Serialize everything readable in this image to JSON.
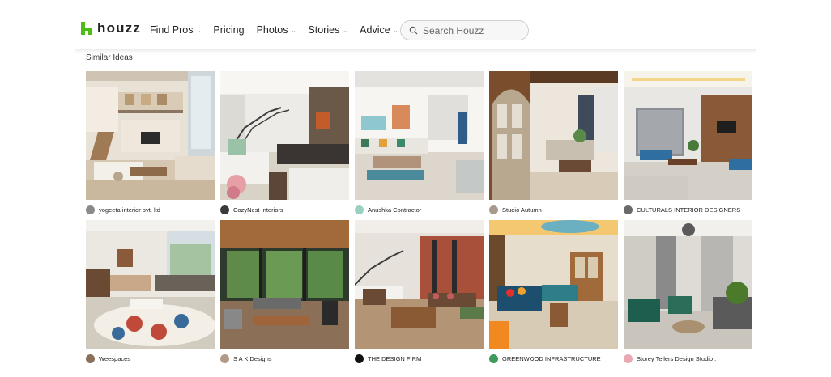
{
  "header": {
    "logo_text": "houzz",
    "nav": [
      {
        "label": "Find Pros",
        "dropdown": true
      },
      {
        "label": "Pricing",
        "dropdown": false
      },
      {
        "label": "Photos",
        "dropdown": true
      },
      {
        "label": "Stories",
        "dropdown": true
      },
      {
        "label": "Advice",
        "dropdown": true
      }
    ],
    "search_placeholder": "Search Houzz",
    "brand_color": "#4dbc15"
  },
  "section": {
    "title": "Similar Ideas"
  },
  "ideas": [
    {
      "pro": "yogeeta interior pvt. ltd",
      "avatar_color": "#8a8a8a"
    },
    {
      "pro": "CozyNest Interiors",
      "avatar_color": "#3a3a3a"
    },
    {
      "pro": "Anushka Contractor",
      "avatar_color": "#9ad0c2"
    },
    {
      "pro": "Studio Autumn",
      "avatar_color": "#a89a8a"
    },
    {
      "pro": "CULTURALS INTERIOR DESIGNERS",
      "avatar_color": "#6a6a6a"
    },
    {
      "pro": "Weespaces",
      "avatar_color": "#8a6f5a"
    },
    {
      "pro": "S A K Designs",
      "avatar_color": "#b39a86"
    },
    {
      "pro": "THE DESIGN FIRM",
      "avatar_color": "#111111"
    },
    {
      "pro": "GREENWOOD INFRASTRUCTURE",
      "avatar_color": "#3c9a5c"
    },
    {
      "pro": "Storey Tellers Design Studio .",
      "avatar_color": "#e9a9b4"
    }
  ]
}
